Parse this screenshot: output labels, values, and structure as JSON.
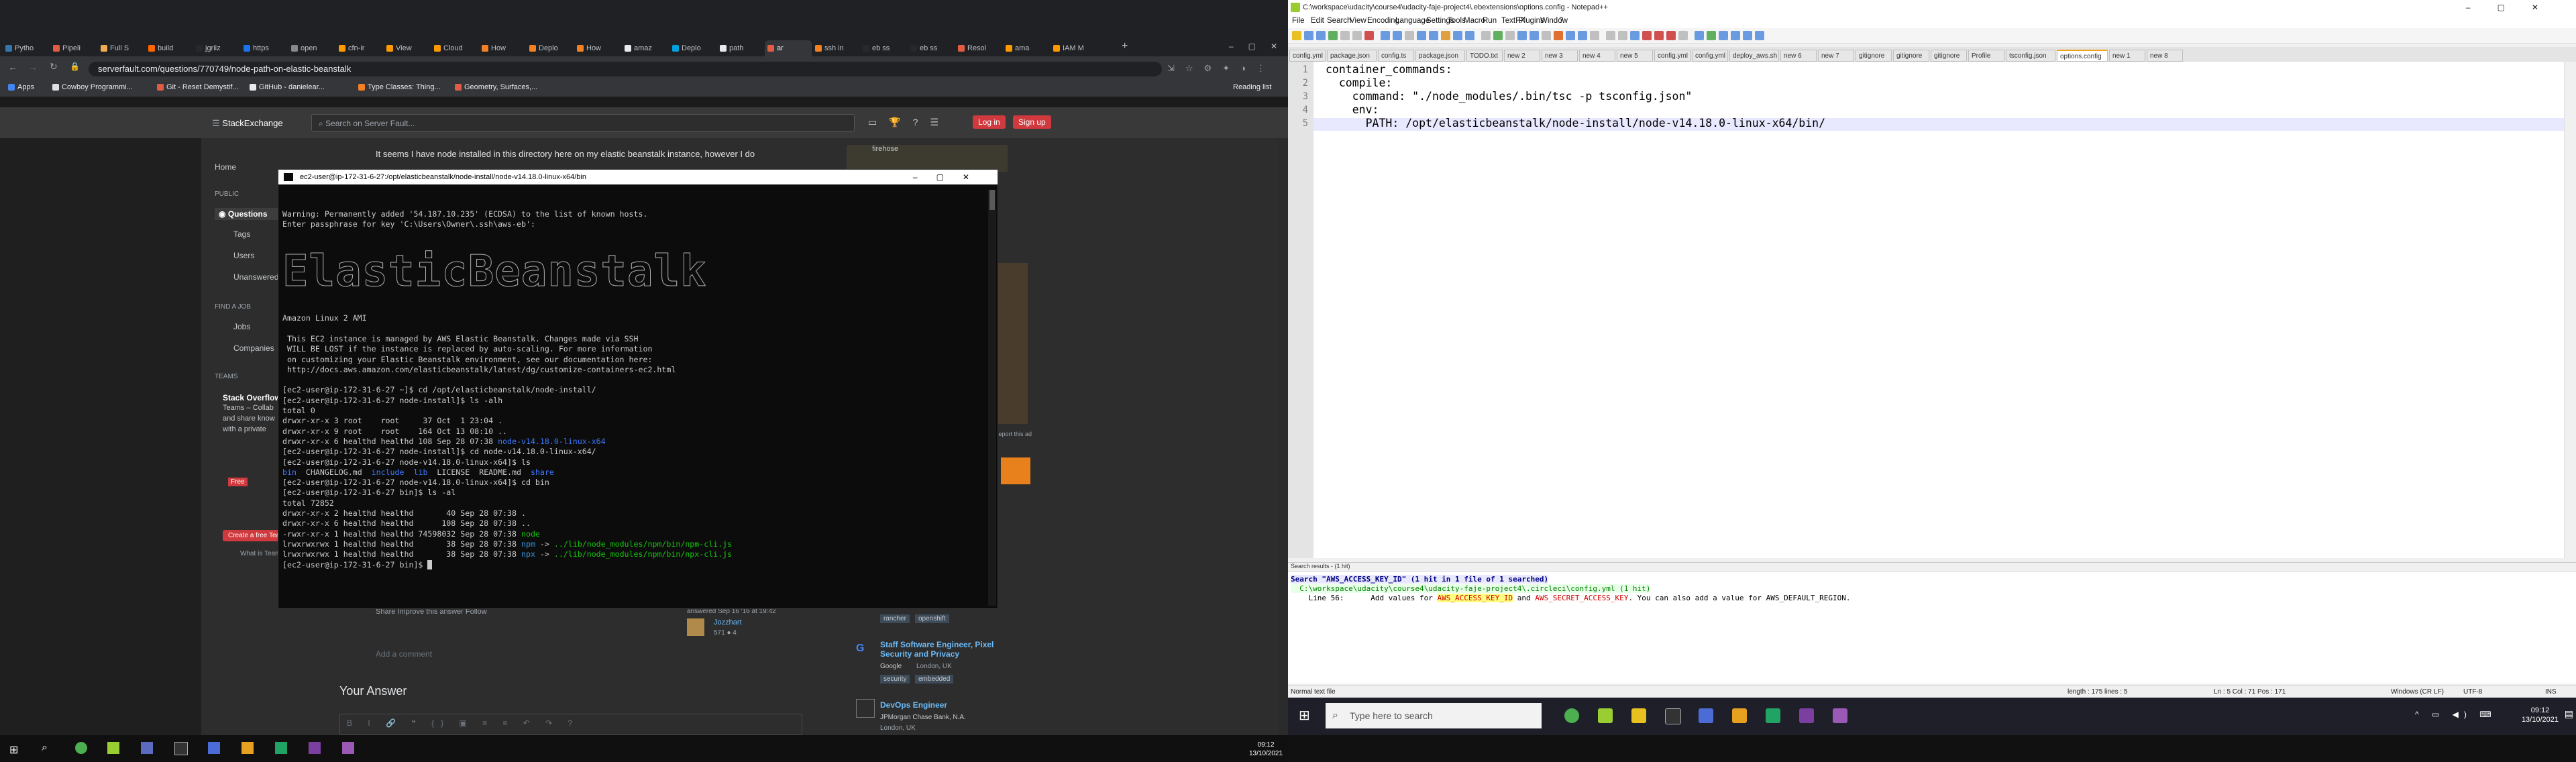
{
  "chrome": {
    "tabs": [
      {
        "label": "Pytho",
        "color": "#3776ab"
      },
      {
        "label": "Pipeli",
        "color": "#e05d44"
      },
      {
        "label": "Full S",
        "color": "#f0ad4e"
      },
      {
        "label": "build",
        "color": "#ff6600"
      },
      {
        "label": "jgriiz",
        "color": "#24292e"
      },
      {
        "label": "https",
        "color": "#1a73e8"
      },
      {
        "label": "open",
        "color": "#888888"
      },
      {
        "label": "cfn-ir",
        "color": "#ff9900"
      },
      {
        "label": "View",
        "color": "#ff9900"
      },
      {
        "label": "Cloud",
        "color": "#ff9900"
      },
      {
        "label": "How",
        "color": "#f48024"
      },
      {
        "label": "Deplo",
        "color": "#f48024"
      },
      {
        "label": "How",
        "color": "#f48024"
      },
      {
        "label": "amaz",
        "color": "#e8eaed"
      },
      {
        "label": "Deplo",
        "color": "#00a1e0"
      },
      {
        "label": "path",
        "color": "#e8eaed"
      },
      {
        "label": "ar",
        "color": "#e05d44"
      },
      {
        "label": "ssh in",
        "color": "#f48024"
      },
      {
        "label": "eb ss",
        "color": "#24292e"
      },
      {
        "label": "eb ss",
        "color": "#24292e"
      },
      {
        "label": "Resol",
        "color": "#e05d44"
      },
      {
        "label": "ama",
        "color": "#ff9900"
      },
      {
        "label": "IAM M",
        "color": "#ff9900"
      }
    ],
    "active_tab_index": 16,
    "url": "serverfault.com/questions/770749/node-path-on-elastic-beanstalk",
    "bookmarks": [
      {
        "label": "Apps",
        "color": "#4285f4"
      },
      {
        "label": "Cowboy Programmi...",
        "color": "#e0e0e0"
      },
      {
        "label": "Git - Reset Demystif...",
        "color": "#e05d44"
      },
      {
        "label": "GitHub - danielear...",
        "color": "#e8eaed"
      },
      {
        "label": "Type Classes: Thing...",
        "color": "#f48024"
      },
      {
        "label": "Geometry, Surfaces,...",
        "color": "#e05d44"
      }
    ],
    "reading_list": "Reading list"
  },
  "serverfault": {
    "logo": "StackExchange",
    "search_placeholder": "Search on Server Fault...",
    "login": "Log in",
    "signup": "Sign up",
    "nav": {
      "home": "Home",
      "public": "PUBLIC",
      "questions": "Questions",
      "tags": "Tags",
      "users": "Users",
      "unanswered": "Unanswered",
      "find_a_job": "FIND A JOB",
      "jobs": "Jobs",
      "companies": "Companies",
      "teams": "TEAMS"
    },
    "teams_blurb": [
      "Stack Overflow for",
      "Teams – Collab",
      "and share know",
      "with a private"
    ],
    "free_badge": "Free",
    "create_team": "Create a free Team",
    "what_is_teams": "What is Teams?",
    "question_text": "It seems I have node installed in this directory here on my elastic beanstalk instance, however I do",
    "share_links": "Share   Improve this answer   Follow",
    "answered": "answered Sep 16 '16 at 19:42",
    "user": "Jozzhart",
    "user_rep": "571  ● 4",
    "add_comment": "Add a comment",
    "your_answer": "Your Answer",
    "right_col": {
      "firehose": "firehose",
      "tags": [
        "rancher",
        "openshift"
      ],
      "report": "Report this ad",
      "job1_title": "Staff Software Engineer, Pixel Security and Privacy",
      "job1_company": "Google",
      "job1_loc": "London, UK",
      "job1_tags": [
        "security",
        "embedded"
      ],
      "job2_title": "DevOps Engineer",
      "job2_company": "JPMorgan Chase Bank, N.A.",
      "job2_loc": "London, UK"
    }
  },
  "terminal": {
    "title": "ec2-user@ip-172-31-6-27:/opt/elasticbeanstalk/node-install/node-v14.18.0-linux-x64/bin",
    "banner": "ElasticBeanstalk",
    "lines_top": [
      "Warning: Permanently added '54.187.10.235' (ECDSA) to the list of known hosts.",
      "Enter passphrase for key 'C:\\Users\\Owner\\.ssh\\aws-eb':"
    ],
    "lines_after_banner": [
      "Amazon Linux 2 AMI",
      "",
      " This EC2 instance is managed by AWS Elastic Beanstalk. Changes made via SSH",
      " WILL BE LOST if the instance is replaced by auto-scaling. For more information",
      " on customizing your Elastic Beanstalk environment, see our documentation here:",
      " http://docs.aws.amazon.com/elasticbeanstalk/latest/dg/customize-containers-ec2.html",
      "",
      "[ec2-user@ip-172-31-6-27 ~]$ cd /opt/elasticbeanstalk/node-install/",
      "[ec2-user@ip-172-31-6-27 node-install]$ ls -alh",
      "total 0",
      "drwxr-xr-x 3 root    root     37 Oct  1 23:04 .",
      "drwxr-xr-x 9 root    root    164 Oct 13 08:10 ..",
      "drwxr-xr-x 6 healthd healthd 108 Sep 28 07:38 {{B}}node-v14.18.0-linux-x64{{/}}",
      "[ec2-user@ip-172-31-6-27 node-install]$ cd node-v14.18.0-linux-x64/",
      "[ec2-user@ip-172-31-6-27 node-v14.18.0-linux-x64]$ ls",
      "{{B}}bin{{/}}  CHANGELOG.md  {{B}}include{{/}}  {{B}}lib{{/}}  LICENSE  README.md  {{B}}share{{/}}",
      "[ec2-user@ip-172-31-6-27 node-v14.18.0-linux-x64]$ cd bin",
      "[ec2-user@ip-172-31-6-27 bin]$ ls -al",
      "total 72852",
      "drwxr-xr-x 2 healthd healthd       40 Sep 28 07:38 .",
      "drwxr-xr-x 6 healthd healthd      108 Sep 28 07:38 ..",
      "-rwxr-xr-x 1 healthd healthd 74598032 Sep 28 07:38 {{G}}node{{/}}",
      "lrwxrwxrwx 1 healthd healthd       38 Sep 28 07:38 {{C}}npm{{/}} -> {{G}}../lib/node_modules/npm/bin/npm-cli.js{{/}}",
      "lrwxrwxrwx 1 healthd healthd       38 Sep 28 07:38 {{C}}npx{{/}} -> {{G}}../lib/node_modules/npm/bin/npx-cli.js{{/}}",
      "[ec2-user@ip-172-31-6-27 bin]$ {{CUR}}"
    ]
  },
  "taskbar_left": {
    "time": "09:12",
    "date": "13/10/2021"
  },
  "notepadpp": {
    "title": "C:\\workspace\\udacity\\course4\\udacity-faje-project4\\.ebextensions\\options.config - Notepad++",
    "menu": [
      "File",
      "Edit",
      "Search",
      "View",
      "Encoding",
      "Language",
      "Settings",
      "Tools",
      "Macro",
      "Run",
      "TextFX",
      "Plugins",
      "Window",
      "?"
    ],
    "tabs": [
      "config.yml",
      "package.json",
      "config.ts",
      "package.json",
      "TODO.txt",
      "new 2",
      "new 3",
      "new 4",
      "new 5",
      "config.yml",
      "config.yml",
      "deploy_aws.sh",
      "new 6",
      "new 7",
      "gitignore",
      "gitignore",
      "gitignore",
      "Profile",
      "tsconfig.json",
      "options.config",
      "new 1",
      "new 8"
    ],
    "active_tab_index": 19,
    "code_lines": [
      "container_commands:",
      "  compile:",
      "    command: \"./node_modules/.bin/tsc -p tsconfig.json\"",
      "    env:",
      "      PATH: /opt/elasticbeanstalk/node-install/node-v14.18.0-linux-x64/bin/"
    ],
    "search_header": "Search results - (1 hit)",
    "search_line1": "Search \"AWS_ACCESS_KEY_ID\" (1 hit in 1 file of 1 searched)",
    "search_line2": "  C:\\workspace\\udacity\\course4\\udacity-faje-project4\\.circleci\\config.yml (1 hit)",
    "search_line3_pre": "    Line 56:      Add values for ",
    "search_hit1": "AWS_ACCESS_KEY_ID",
    "search_line3_mid": " and ",
    "search_hit2": "AWS_SECRET_ACCESS_KEY",
    "search_line3_post": ". You can also add a value for AWS_DEFAULT_REGION.",
    "status": {
      "type": "Normal text file",
      "length": "length : 175    lines : 5",
      "pos": "Ln : 5    Col : 71    Pos : 171",
      "eol": "Windows (CR LF)",
      "enc": "UTF-8",
      "ins": "INS"
    }
  },
  "taskbar_right": {
    "search_placeholder": "Type here to search",
    "time": "09:12",
    "date": "13/10/2021"
  }
}
